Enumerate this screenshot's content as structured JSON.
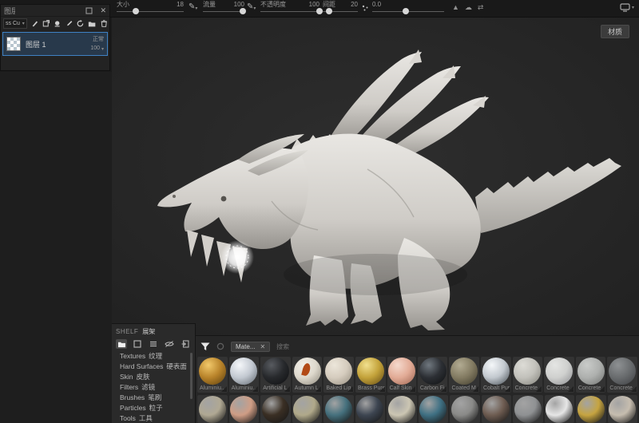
{
  "toolbar": {
    "sliders": [
      {
        "label": "大小",
        "value": "18"
      },
      {
        "label": "流量",
        "value": "100"
      },
      {
        "label": "不透明度",
        "value": "100"
      },
      {
        "label": "间距",
        "value": "20"
      }
    ],
    "scatter_value": "0.0",
    "icons": {
      "pen": "pen-pressure toggle ✎",
      "scatter_dots": "scatter-dots",
      "profile": "▲",
      "cloud": "☁",
      "symmetry": "⇄",
      "display": "display-mode panel toggle"
    }
  },
  "layers_panel": {
    "title": "图层",
    "blend_dropdown": "ss Cu",
    "layer": {
      "name": "图层 1",
      "blend": "正常",
      "opacity": "100"
    }
  },
  "viewport": {
    "view_mode_label": "材质"
  },
  "shelf": {
    "title_en": "SHELF",
    "title_zh": "展架",
    "categories": [
      {
        "en": "Textures",
        "zh": "纹理"
      },
      {
        "en": "Hard Surfaces",
        "zh": "硬表面"
      },
      {
        "en": "Skin",
        "zh": "皮肤"
      },
      {
        "en": "Filters",
        "zh": "滤镜"
      },
      {
        "en": "Brushes",
        "zh": "笔刷"
      },
      {
        "en": "Particles",
        "zh": "粒子"
      },
      {
        "en": "Tools",
        "zh": "工具"
      }
    ]
  },
  "materials": {
    "filter_chip": "Mate...",
    "search_placeholder": "搜索",
    "row1": [
      {
        "name": "Aluminiu...",
        "base": "#b8832a",
        "hi": "#f2c96b",
        "dark": "#6b4a12"
      },
      {
        "name": "Aluminiu...",
        "base": "#c3c9d1",
        "hi": "#f5f7fa",
        "dark": "#70777f"
      },
      {
        "name": "Artificial L...",
        "base": "#27292c",
        "hi": "#585b60",
        "dark": "#121315"
      },
      {
        "name": "Autumn L...",
        "base": "#ddd8cc",
        "hi": "#f2efe8",
        "dark": "#9b968a",
        "accent": "#b24a16"
      },
      {
        "name": "Baked Lig...",
        "base": "#d5ccbe",
        "hi": "#ece6da",
        "dark": "#a0988a"
      },
      {
        "name": "Brass Pure",
        "base": "#c3a23a",
        "hi": "#f1e08e",
        "dark": "#73591a"
      },
      {
        "name": "Calf Skin",
        "base": "#e2ab96",
        "hi": "#f5d9cd",
        "dark": "#a9705c"
      },
      {
        "name": "Carbon Fi...",
        "base": "#2c2f34",
        "hi": "#70787f",
        "dark": "#131517"
      },
      {
        "name": "Coated M...",
        "base": "#837b62",
        "hi": "#b2ab92",
        "dark": "#4b4636"
      },
      {
        "name": "Cobalt Pure",
        "base": "#c2c8ce",
        "hi": "#f4f7f9",
        "dark": "#596066"
      },
      {
        "name": "Concrete ...",
        "base": "#c2c1bb",
        "hi": "#dddcd6",
        "dark": "#8d8c85"
      },
      {
        "name": "Concrete ...",
        "base": "#cfd0ce",
        "hi": "#e4e5e3",
        "dark": "#97989b"
      },
      {
        "name": "Concrete ...",
        "base": "#aeb0ae",
        "hi": "#c9cbc9",
        "dark": "#7b7d7b"
      },
      {
        "name": "Concrete ...",
        "base": "#696c6e",
        "hi": "#8e9193",
        "dark": "#45474a"
      }
    ],
    "row2_colors": [
      "#b0a893",
      "#cf9d85",
      "#3a2f24",
      "#b0a98a",
      "#45707d",
      "#3d4551",
      "#ccc6b3",
      "#3f7083",
      "#8a8a88",
      "#6e5c51",
      "#8f9193",
      "#e6e6e6",
      "#c6a440",
      "#c6bdaf"
    ]
  },
  "colors": {
    "selection_blue": "#3f82c4",
    "panel_bg": "#232323",
    "viewport_bg": "#262626",
    "clay": "#d6d3ce"
  }
}
